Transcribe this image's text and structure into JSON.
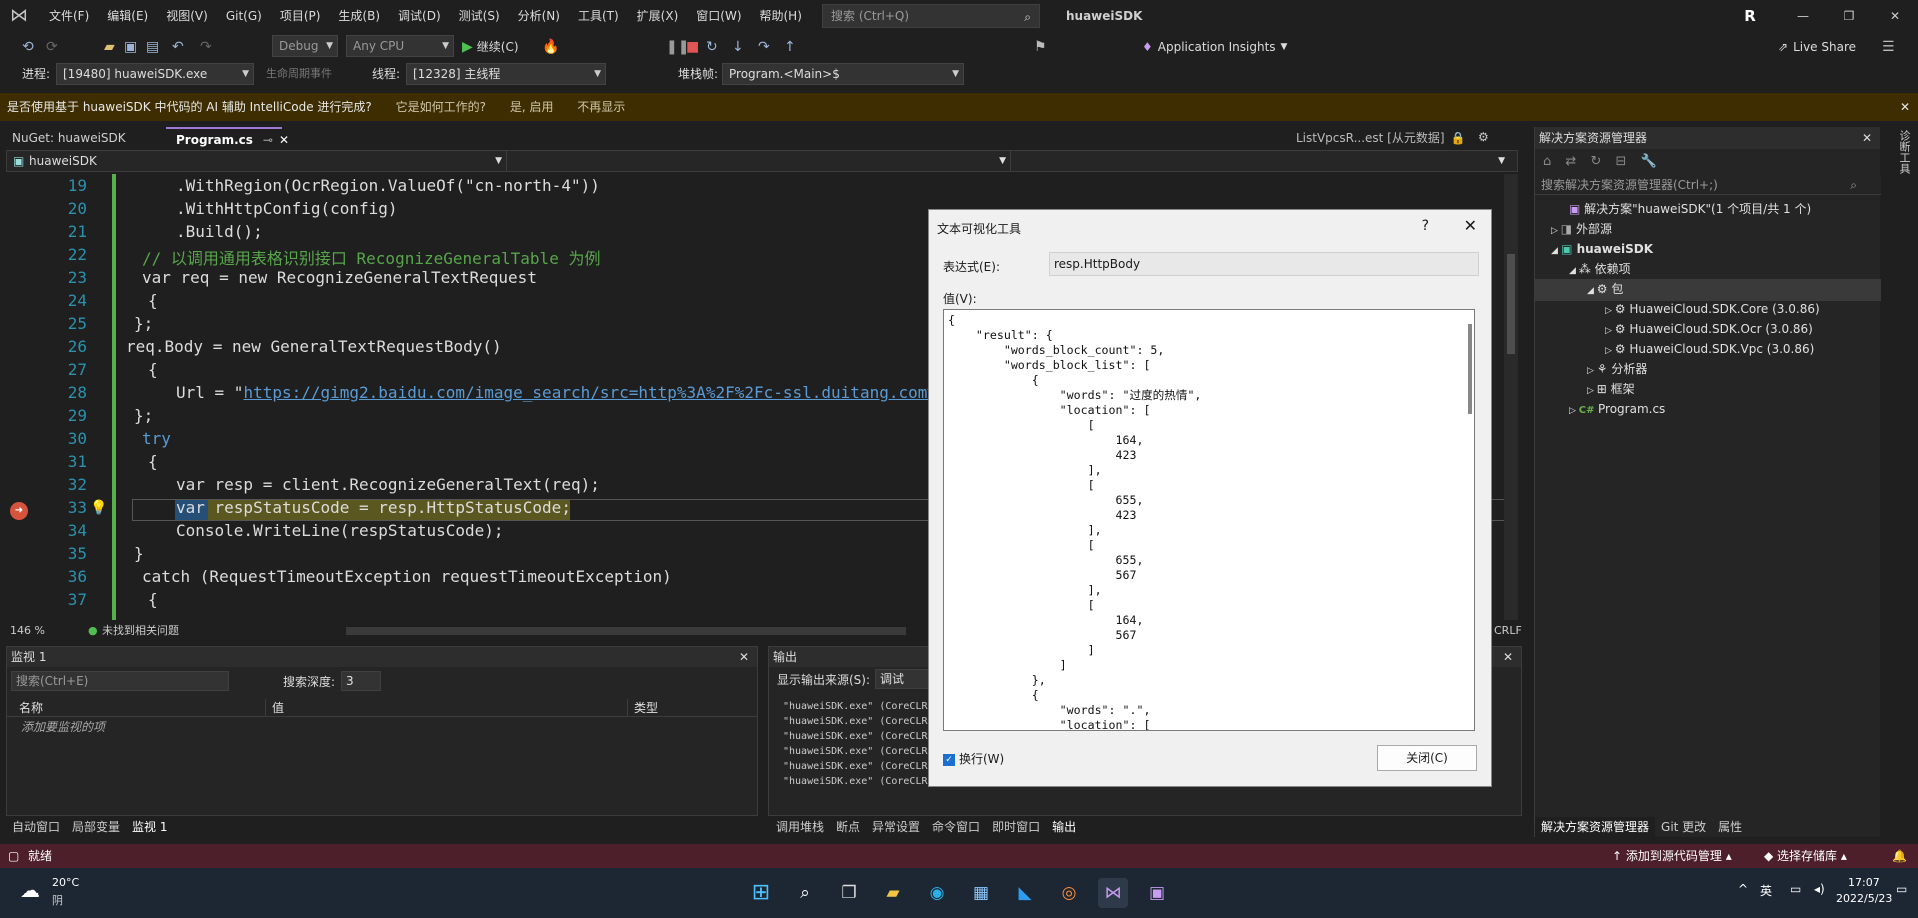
{
  "title_bar": {
    "menu": [
      "文件(F)",
      "编辑(E)",
      "视图(V)",
      "Git(G)",
      "项目(P)",
      "生成(B)",
      "调试(D)",
      "测试(S)",
      "分析(N)",
      "工具(T)",
      "扩展(X)",
      "窗口(W)",
      "帮助(H)"
    ],
    "search_placeholder": "搜索 (Ctrl+Q)",
    "app_title": "huaweiSDK",
    "avatar": "R"
  },
  "toolbar": {
    "config": "Debug",
    "platform": "Any CPU",
    "continue": "继续(C)",
    "insights": "Application Insights",
    "live_share": "Live Share"
  },
  "toolbar2": {
    "process_label": "进程:",
    "process": "[19480] huaweiSDK.exe",
    "lifecycle": "生命周期事件",
    "thread_label": "线程:",
    "thread": "[12328] 主线程",
    "stack_label": "堆栈帧:",
    "stack": "Program.<Main>$"
  },
  "notification": {
    "text": "是否使用基于 huaweiSDK 中代码的 AI 辅助 IntelliCode 进行完成?",
    "how": "它是如何工作的?",
    "yes": "是, 启用",
    "no": "不再显示"
  },
  "tabs": {
    "nuget": "NuGet: huaweiSDK",
    "program": "Program.cs",
    "right": "ListVpcsR...est [从元数据]"
  },
  "nav": {
    "project": "huaweiSDK"
  },
  "editor": {
    "lines": [
      "19",
      "20",
      "21",
      "22",
      "23",
      "24",
      "25",
      "26",
      "27",
      "28",
      "29",
      "30",
      "31",
      "32",
      "33",
      "34",
      "35",
      "36",
      "37"
    ],
    "code": [
      ".WithRegion(OcrRegion.ValueOf(\"cn-north-4\"))",
      ".WithHttpConfig(config)",
      ".Build();",
      "// 以调用通用表格识别接口 RecognizeGeneralTable 为例",
      "var req = new RecognizeGeneralTextRequest",
      "{",
      "};",
      "req.Body = new GeneralTextRequestBody()",
      "{",
      "https://gimg2.baidu.com/image_search/src=http%3A%2F%2Fc-ssl.duitang.com%2",
      "};",
      "try",
      "{",
      "var resp = client.RecognizeGeneralText(req);",
      "var respStatusCode = resp.HttpStatusCode;",
      "Console.WriteLine(respStatusCode);",
      "}",
      "catch (RequestTimeoutException requestTimeoutException)",
      "{"
    ]
  },
  "editor_status": {
    "zoom": "146 %",
    "issues": "未找到相关问题",
    "eol": "CRLF"
  },
  "watch": {
    "title": "监视 1",
    "search": "搜索(Ctrl+E)",
    "depth_label": "搜索深度:",
    "depth": "3",
    "col_name": "名称",
    "col_value": "值",
    "col_type": "类型",
    "add_item": "添加要监视的项"
  },
  "output": {
    "title": "输出",
    "source_label": "显示输出来源(S):",
    "source": "调试",
    "lines": [
      "\"huaweiSDK.exe\" (CoreCLR",
      "\"huaweiSDK.exe\" (CoreCLR",
      "\"huaweiSDK.exe\" (CoreCLR",
      "\"huaweiSDK.exe\" (CoreCLR",
      "\"huaweiSDK.exe\" (CoreCLR",
      "\"huaweiSDK.exe\" (CoreCLR"
    ]
  },
  "bottom_tabs_left": [
    "自动窗口",
    "局部变量",
    "监视 1"
  ],
  "bottom_tabs_right": [
    "调用堆栈",
    "断点",
    "异常设置",
    "命令窗口",
    "即时窗口",
    "输出"
  ],
  "solution": {
    "title": "解决方案资源管理器",
    "search": "搜索解决方案资源管理器(Ctrl+;)",
    "root": "解决方案\"huaweiSDK\"(1 个项目/共 1 个)",
    "external": "外部源",
    "project": "huaweiSDK",
    "deps": "依赖项",
    "packages": "包",
    "pkg1": "HuaweiCloud.SDK.Core (3.0.86)",
    "pkg2": "HuaweiCloud.SDK.Ocr (3.0.86)",
    "pkg3": "HuaweiCloud.SDK.Vpc (3.0.86)",
    "analyzers": "分析器",
    "frameworks": "框架",
    "file": "Program.cs",
    "tabs": [
      "解决方案资源管理器",
      "Git 更改",
      "属性"
    ],
    "side": "诊断工具"
  },
  "dialog": {
    "title": "文本可视化工具",
    "expr_label": "表达式(E):",
    "expr": "resp.HttpBody",
    "value_label": "值(V):",
    "value": "{\n    \"result\": {\n        \"words_block_count\": 5,\n        \"words_block_list\": [\n            {\n                \"words\": \"过度的热情\",\n                \"location\": [\n                    [\n                        164,\n                        423\n                    ],\n                    [\n                        655,\n                        423\n                    ],\n                    [\n                        655,\n                        567\n                    ],\n                    [\n                        164,\n                        567\n                    ]\n                ]\n            },\n            {\n                \"words\": \".\",\n                \"location\": [",
    "wrap": "换行(W)",
    "close": "关闭(C)"
  },
  "statusbar": {
    "ready": "就绪",
    "add_source": "添加到源代码管理",
    "repo": "选择存储库"
  },
  "taskbar": {
    "temp": "20°C",
    "weather": "阴",
    "lang": "英",
    "time": "17:07",
    "date": "2022/5/23"
  }
}
